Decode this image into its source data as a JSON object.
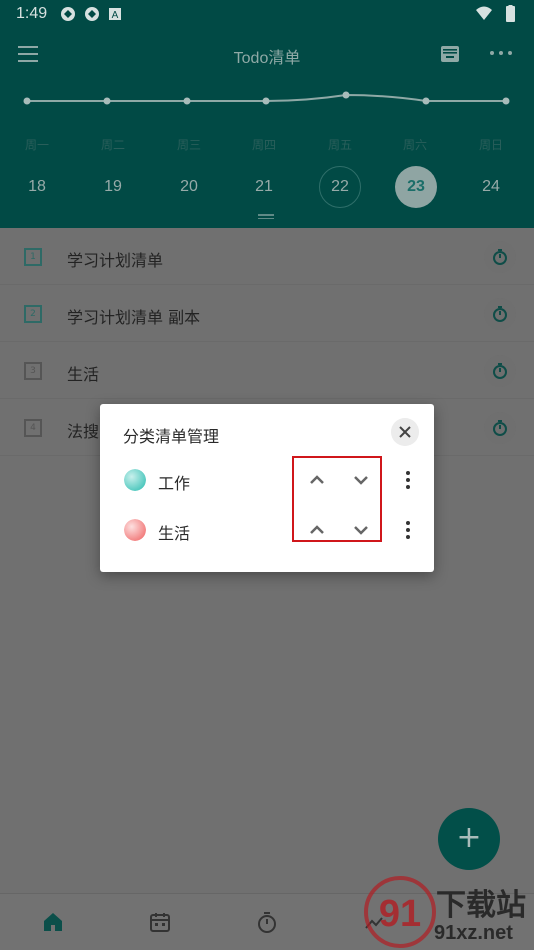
{
  "status_bar": {
    "time": "1:49"
  },
  "app_bar": {
    "title": "Todo清单"
  },
  "week": {
    "days": [
      "周一",
      "周二",
      "周三",
      "周四",
      "周五",
      "周六",
      "周日"
    ],
    "dates": [
      "18",
      "19",
      "20",
      "21",
      "22",
      "23",
      "24"
    ],
    "selected_date": "23",
    "today_date": "22"
  },
  "lists": [
    {
      "num": "1",
      "label": "学习计划清单"
    },
    {
      "num": "2",
      "label": "学习计划清单 副本"
    },
    {
      "num": "3",
      "label": "生活"
    },
    {
      "num": "4",
      "label": "法搜"
    }
  ],
  "dialog": {
    "title": "分类清单管理",
    "categories": [
      {
        "label": "工作",
        "color": "#4cc7bd"
      },
      {
        "label": "生活",
        "color": "#f27c7c"
      }
    ]
  },
  "fab": {
    "label": "+"
  },
  "watermark": {
    "brand": "下载站",
    "url": "91xz.net"
  },
  "colors": {
    "primary": "#014a45",
    "accent": "#1b6e69",
    "highlight_box": "#d0161b"
  }
}
